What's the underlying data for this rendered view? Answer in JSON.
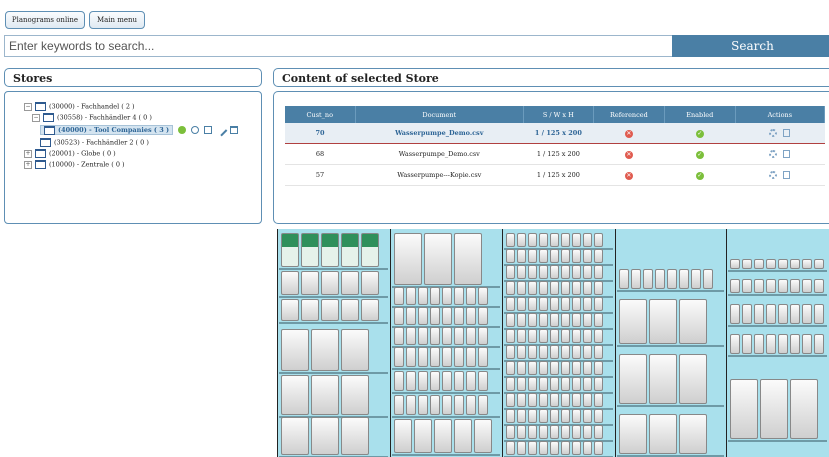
{
  "topnav": {
    "planograms_online": "Planograms online",
    "main_menu": "Main menu"
  },
  "search": {
    "placeholder": "Enter keywords to search...",
    "button": "Search"
  },
  "stores_panel": {
    "title": "Stores",
    "tree": [
      {
        "label": "(30000) - Fachhandel ( 2 )",
        "expander": "−"
      },
      {
        "label": "(30558) - Fachhändler 4 ( 0 )",
        "expander": "−"
      },
      {
        "label": "(40000) - Tool Companies ( 3 )",
        "selected": true
      },
      {
        "label": "(30523) - Fachhändler 2 ( 0 )"
      },
      {
        "label": "(20001) - Globe ( 0 )",
        "expander": "+"
      },
      {
        "label": "(10000) - Zentrale ( 0 )",
        "expander": "+"
      }
    ]
  },
  "content_panel": {
    "title": "Content of selected Store",
    "columns": [
      "Cust_no",
      "Document",
      "S / W x H",
      "Referenced",
      "Enabled",
      "Actions"
    ],
    "rows": [
      {
        "cust_no": "70",
        "document": "Wasserpumpe_Demo.csv",
        "size": "1 / 125 x 200",
        "referenced": false,
        "enabled": true
      },
      {
        "cust_no": "68",
        "document": "Wasserpumpe_Demo.csv",
        "size": "1 / 125 x 200",
        "referenced": false,
        "enabled": true
      },
      {
        "cust_no": "57",
        "document": "Wasserpumpe---Kopie.csv",
        "size": "1 / 125 x 200",
        "referenced": false,
        "enabled": true
      }
    ]
  },
  "colors": {
    "accent": "#4a7fa5",
    "planogram_bg": "#a9e0ec",
    "ok": "#7cbf3b",
    "error": "#e05b4f"
  }
}
